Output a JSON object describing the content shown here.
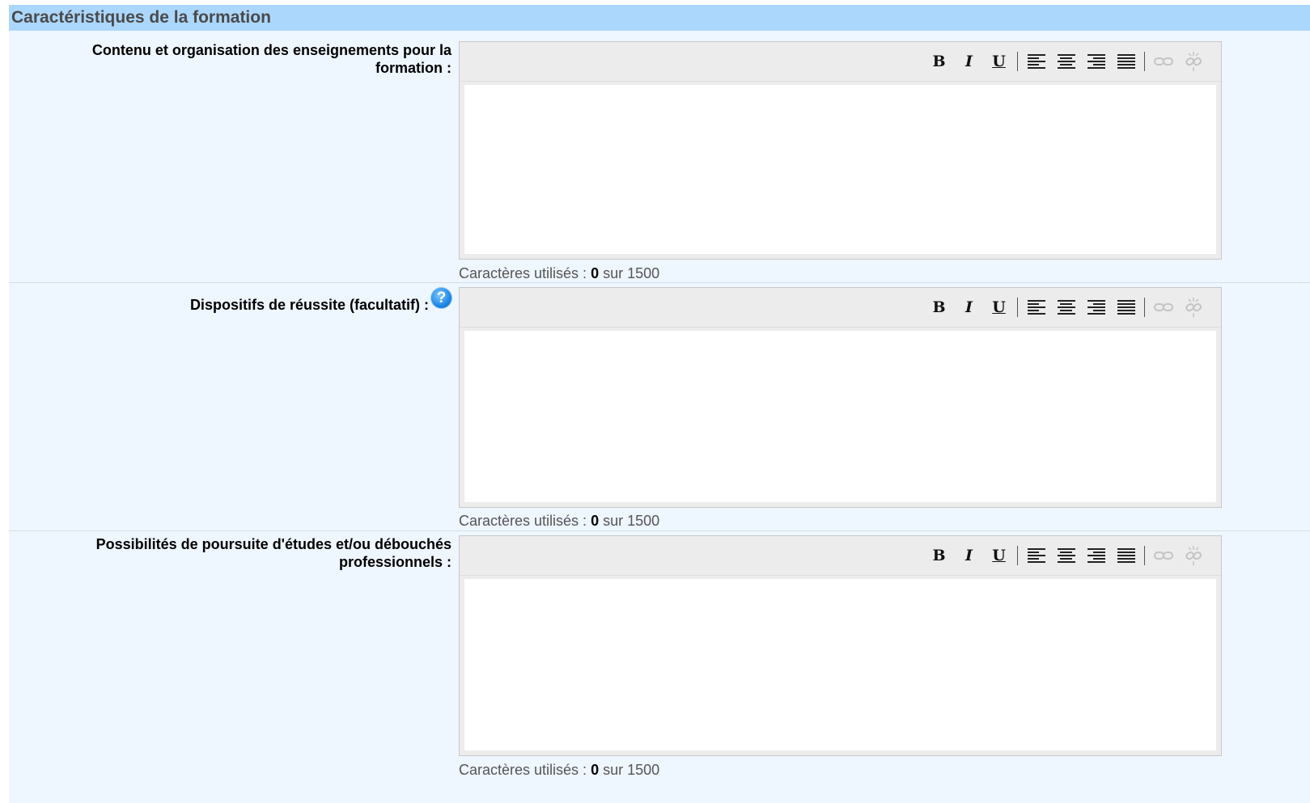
{
  "section": {
    "title": "Caractéristiques de la formation"
  },
  "fields": [
    {
      "label": "Contenu et organisation des enseignements pour la formation :",
      "value": "",
      "counter_prefix": "Caractères utilisés : ",
      "counter_used": "0",
      "counter_suffix": " sur 1500"
    },
    {
      "label": "Dispositifs de réussite (facultatif) :",
      "help_icon": "question-mark-icon",
      "value": "",
      "counter_prefix": "Caractères utilisés : ",
      "counter_used": "0",
      "counter_suffix": " sur 1500"
    },
    {
      "label": "Possibilités de poursuite d'études et/ou débouchés professionnels :",
      "value": "",
      "counter_prefix": "Caractères utilisés : ",
      "counter_used": "0",
      "counter_suffix": " sur 1500"
    }
  ],
  "toolbar": {
    "bold": "B",
    "italic": "I",
    "underline": "U",
    "icons": [
      "bold-icon",
      "italic-icon",
      "underline-icon",
      "align-left-icon",
      "align-center-icon",
      "align-right-icon",
      "align-justify-icon",
      "link-icon",
      "unlink-icon"
    ]
  },
  "colors": {
    "header_bg": "#acd7fd",
    "panel_bg": "#eef6ff",
    "help_icon": "#1e88e5"
  }
}
